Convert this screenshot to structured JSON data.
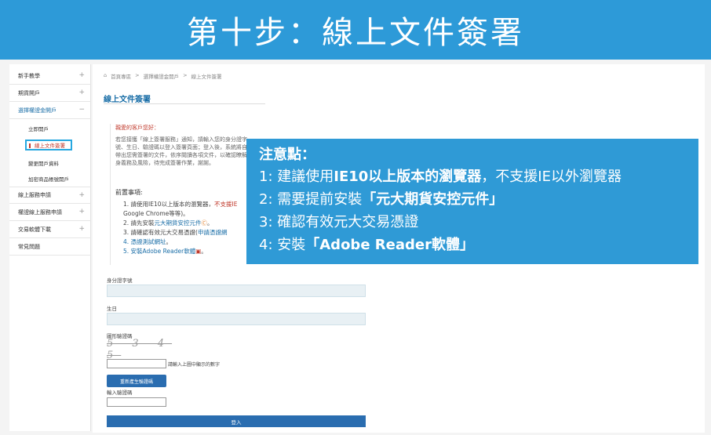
{
  "banner": {
    "title": "第十步：線上文件簽署"
  },
  "sidebar": {
    "items": [
      {
        "label": "新手教學",
        "expand": "+"
      },
      {
        "label": "期貨開戶",
        "expand": "+"
      },
      {
        "label": "選擇權證金開戶",
        "expand": "−"
      }
    ],
    "sub_items": [
      {
        "label": "立即開戶"
      },
      {
        "label": "線上文件簽署"
      },
      {
        "label": "變更開戶資料"
      },
      {
        "label": "加密商品帳號開戶"
      }
    ],
    "items2": [
      {
        "label": "線上服務申請",
        "expand": "+"
      },
      {
        "label": "權證線上服務申請",
        "expand": "+"
      },
      {
        "label": "交易軟體下載",
        "expand": "+"
      },
      {
        "label": "常見問題",
        "expand": ""
      }
    ]
  },
  "breadcrumb": {
    "home": "首頁專區",
    "sep1": ">",
    "level1": "選擇權證金開戶",
    "sep2": ">",
    "level2": "線上文件簽署"
  },
  "page": {
    "title": "線上文件簽署"
  },
  "notice": {
    "greeting": "親愛的客戶您好：",
    "paragraph": "若您接獲「線上簽署服務」通知，請輸入您的身分證字號、生日、驗證碼以登入簽署頁面；登入後，系統將自動帶出您需簽署的文件，依序閱讀各項文件，以確認瞭解自身義務及風險，待完成簽署作業，謝謝。",
    "precautions_title": "前置事項:",
    "step1_prefix": "1. 請使用IE10以上版本的瀏覽器，",
    "step1_red": "不支援IE",
    "step1_suffix": "Google Chrome等等)。",
    "step2_prefix": "2. 請先安裝",
    "step2_link": "元大期貨安控元件",
    "step2_suffix": "。",
    "step3_prefix": "3. 請確認有效元大交易憑證(",
    "step3_link": "申請憑證網",
    "step4_link": "4. 憑證測試網址",
    "step4_suffix": "。",
    "step5_link": "5. 安裝Adobe Reader軟體",
    "step5_suffix": "。"
  },
  "form": {
    "id_label": "身分證字號",
    "birthday_label": "生日",
    "captcha_label": "圖形驗證碼",
    "captcha_image_text": "5 3 4 5",
    "captcha_hint": "請輸入上圖中顯示的數字",
    "refresh_button": "重新產生驗證碼",
    "password_label": "輸入驗證碼",
    "login_button": "登入"
  },
  "callout": {
    "title": "注意點：",
    "l1_num": "1: ",
    "l1_pre": "建議使用",
    "l1_bold": "IE10以上版本的瀏覽器",
    "l1_post": "，不支援IE以外瀏覽器",
    "l2_num": "2: ",
    "l2_pre": "需要提前安裝",
    "l2_bold": "「元大期貨安控元件」",
    "l3_num": "3: ",
    "l3_pre": "確認有效元大交易憑證",
    "l4_num": "4: ",
    "l4_pre": "安裝",
    "l4_bold": "「Adobe Reader軟體」"
  },
  "colors": {
    "banner": "#2d9ad8",
    "callout": "#2f9ad6",
    "primary_button": "#2a6db0",
    "accent_red": "#c0392b",
    "highlight_border": "#27a8e0"
  }
}
